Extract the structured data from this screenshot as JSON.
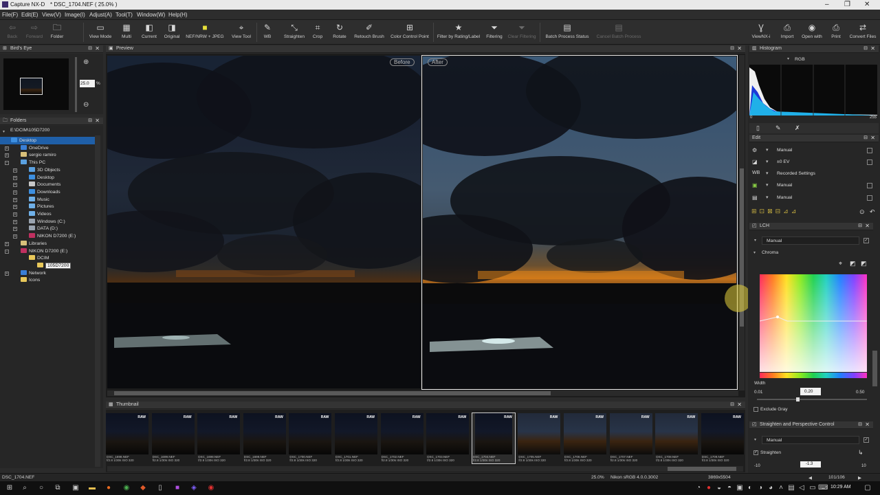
{
  "window": {
    "app_name": "Capture NX-D",
    "document_title": "* DSC_1704.NEF ( 25.0% )"
  },
  "menu": [
    "File(F)",
    "Edit(E)",
    "View(V)",
    "Image(I)",
    "Adjust(A)",
    "Tool(T)",
    "Window(W)",
    "Help(H)"
  ],
  "toolbar": {
    "back": "Back",
    "forward": "Forward",
    "folder": "Folder",
    "view_mode": "View Mode",
    "multi": "Multi",
    "current": "Current",
    "original": "Original",
    "nef_jpeg": "NEF/NRW + JPEG",
    "view_tool": "View Tool",
    "wb": "WB",
    "straighten": "Straighten",
    "crop": "Crop",
    "rotate": "Rotate",
    "retouch_brush": "Retouch Brush",
    "color_control_point": "Color Control Point",
    "filter_rating": "Filter by Rating/Label",
    "filtering": "Filtering",
    "clear_filtering": "Clear Filtering",
    "batch_status": "Batch Process Status",
    "cancel_batch": "Cancel Batch Process",
    "viewnx": "ViewNX-i",
    "import": "Import",
    "open_with": "Open with",
    "print": "Print",
    "convert": "Convert Files"
  },
  "birds_eye": {
    "title": "Bird's Eye",
    "zoom_value": "25.0",
    "zoom_unit": "%"
  },
  "folders": {
    "title": "Folders",
    "path": "E:\\DCIM\\105D7200",
    "items": [
      {
        "label": "Desktop",
        "color": "#3d8fe0"
      },
      {
        "label": "OneDrive",
        "color": "#3a7fd6"
      },
      {
        "label": "sergio ramiro",
        "color": "#d8c07a"
      },
      {
        "label": "This PC",
        "color": "#5aa0e0"
      },
      {
        "label": "3D Objects",
        "color": "#5aa0e0"
      },
      {
        "label": "Desktop",
        "color": "#3d8fe0"
      },
      {
        "label": "Documents",
        "color": "#c8c8c8"
      },
      {
        "label": "Downloads",
        "color": "#3d8fe0"
      },
      {
        "label": "Music",
        "color": "#6fb0e8"
      },
      {
        "label": "Pictures",
        "color": "#6fb0e8"
      },
      {
        "label": "Videos",
        "color": "#6fb0e8"
      },
      {
        "label": "Windows (C:)",
        "color": "#9aa4b0"
      },
      {
        "label": "DATA (D:)",
        "color": "#9aa4b0"
      },
      {
        "label": "NIKON D7200 (E:)",
        "color": "#c03060"
      },
      {
        "label": "Libraries",
        "color": "#d8c07a"
      },
      {
        "label": "NIKON D7200 (E:)",
        "color": "#c03060"
      },
      {
        "label": "DCIM",
        "color": "#e8c85a"
      },
      {
        "label": "105D7200",
        "color": "#e8c85a"
      },
      {
        "label": "Network",
        "color": "#3a7fd6"
      },
      {
        "label": "Icons",
        "color": "#e8c85a"
      }
    ]
  },
  "preview": {
    "title": "Preview",
    "before_label": "Before",
    "after_label": "After"
  },
  "thumbnail": {
    "title": "Thumbnail",
    "raw_badge": "RAW",
    "items": [
      {
        "name": "DSC_1698.NEF",
        "info": "f/2.8 1/30s ISO 320"
      },
      {
        "name": "DSC_1699.NEF",
        "info": "f/2.8 1/30s ISO 320"
      },
      {
        "name": "DSC_1698.NEF",
        "info": "f/2.8 1/30s ISO 320"
      },
      {
        "name": "DSC_1699.NEF",
        "info": "f/2.8 1/30s ISO 320"
      },
      {
        "name": "DSC_1700.NEF",
        "info": "f/2.8 1/30s ISO 320"
      },
      {
        "name": "DSC_1701.NEF",
        "info": "f/2.8 1/30s ISO 320"
      },
      {
        "name": "DSC_1702.NEF",
        "info": "f/2.8 1/30s ISO 320"
      },
      {
        "name": "DSC_1703.NEF",
        "info": "f/2.8 1/30s ISO 320"
      },
      {
        "name": "DSC_1704.NEF",
        "info": "f/2.8 1/30s ISO 320"
      },
      {
        "name": "DSC_1705.NEF",
        "info": "f/2.8 1/30s ISO 320"
      },
      {
        "name": "DSC_1706.NEF",
        "info": "f/2.8 1/30s ISO 320"
      },
      {
        "name": "DSC_1707.NEF",
        "info": "f/2.8 1/30s ISO 320"
      },
      {
        "name": "DSC_1708.NEF",
        "info": "f/2.8 1/30s ISO 320"
      },
      {
        "name": "DSC_1709.NEF",
        "info": "f/2.8 1/30s ISO 320"
      }
    ]
  },
  "histogram": {
    "title": "Histogram",
    "channel": "RGB",
    "min": "0",
    "max": "255"
  },
  "edit": {
    "title": "Edit",
    "rows": [
      "Manual",
      "±0 EV",
      "Recorded Settings",
      "Manual",
      "Manual"
    ]
  },
  "lch": {
    "title": "LCH",
    "preset": "Manual",
    "channel": "Chroma",
    "width_label": "Width",
    "width_min": "0.01",
    "width_value": "0.20",
    "width_max": "0.50",
    "exclude_gray": "Exclude Gray"
  },
  "straighten_panel": {
    "title": "Straighten and Perspective Control",
    "preset": "Manual",
    "straighten_label": "Straighten",
    "min": "-10",
    "value": "-1.3",
    "max": "10"
  },
  "status": {
    "filename": "DSC_1704.NEF",
    "zoom": "25.0%",
    "profile": "Nikon sRGB 4.0.0.3002",
    "dimensions": "3869x5504",
    "counter": "101/106"
  },
  "taskbar": {
    "time": "10:29 AM"
  }
}
